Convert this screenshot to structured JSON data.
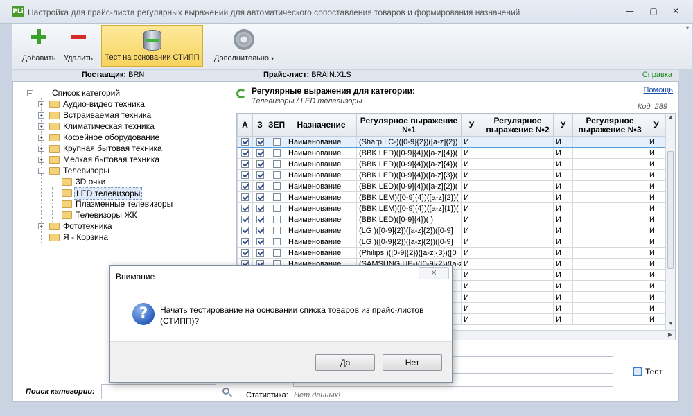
{
  "window": {
    "app_icon": "PLi",
    "title": "Настройка для прайс-листа регулярных выражений для автоматического сопоставления товаров и формирования назначений",
    "minimize": "—",
    "maximize": "▢",
    "close": "✕"
  },
  "ribbon": {
    "add_label": "Добавить",
    "delete_label": "Удалить",
    "test_label": "Тест на основании СТИПП",
    "more_label": "Дополнительно",
    "more_arrow": "▾"
  },
  "info": {
    "supplier_label": "Поставщик:",
    "supplier_value": "BRN",
    "pricelist_label": "Прайс-лист:",
    "pricelist_value": "BRAIN.XLS",
    "help": "Справка"
  },
  "tree": {
    "root": "Список категорий",
    "items": [
      "Аудио-видео техника",
      "Встраиваемая техника",
      "Климатическая техника",
      "Кофейное оборудование",
      "Крупная бытовая техника",
      "Мелкая бытовая техника",
      "Телевизоры"
    ],
    "tv_children": [
      "3D очки",
      "LED телевизоры",
      "Плазменные телевизоры",
      "Телевизоры ЖК"
    ],
    "after": [
      "Фототехника",
      "Я - Корзина"
    ]
  },
  "search": {
    "label": "Поиск категории:",
    "value": ""
  },
  "regex_panel": {
    "title": "Регулярные выражения для категории:",
    "path": "Телевизоры / LED телевизоры",
    "help": "Помощь",
    "code": "Код: 289",
    "columns": [
      "А",
      "З",
      "ЗЕП",
      "Назначение",
      "Регулярное выражение №1",
      "У",
      "Регулярное выражение №2",
      "У",
      "Регулярное выражение №3",
      "У"
    ],
    "rows": [
      {
        "a": true,
        "z": true,
        "zep": false,
        "purpose": "Наименование",
        "r1": "(Sharp LC-)([0-9]{2})([a-z]{2})",
        "u1": "И",
        "r2": "",
        "u2": "И",
        "r3": "",
        "u3": "И"
      },
      {
        "a": true,
        "z": true,
        "zep": false,
        "purpose": "Наименование",
        "r1": "(BBK LED)([0-9]{4})([a-z]{4})(",
        "u1": "И",
        "r2": "",
        "u2": "И",
        "r3": "",
        "u3": "И"
      },
      {
        "a": true,
        "z": true,
        "zep": false,
        "purpose": "Наименование",
        "r1": "(BBK LED)([0-9]{4})([a-z]{4})(",
        "u1": "И",
        "r2": "",
        "u2": "И",
        "r3": "",
        "u3": "И"
      },
      {
        "a": true,
        "z": true,
        "zep": false,
        "purpose": "Наименование",
        "r1": "(BBK LED)([0-9]{4})([a-z]{3})(",
        "u1": "И",
        "r2": "",
        "u2": "И",
        "r3": "",
        "u3": "И"
      },
      {
        "a": true,
        "z": true,
        "zep": false,
        "purpose": "Наименование",
        "r1": "(BBK LED)([0-9]{4})([a-z]{2})(",
        "u1": "И",
        "r2": "",
        "u2": "И",
        "r3": "",
        "u3": "И"
      },
      {
        "a": true,
        "z": true,
        "zep": false,
        "purpose": "Наименование",
        "r1": "(BBK LEM)([0-9]{4})([a-z]{2})(",
        "u1": "И",
        "r2": "",
        "u2": "И",
        "r3": "",
        "u3": "И"
      },
      {
        "a": true,
        "z": true,
        "zep": false,
        "purpose": "Наименование",
        "r1": "(BBK LEM)([0-9]{4})([a-z]{1})(",
        "u1": "И",
        "r2": "",
        "u2": "И",
        "r3": "",
        "u3": "И"
      },
      {
        "a": true,
        "z": true,
        "zep": false,
        "purpose": "Наименование",
        "r1": "(BBK LED)([0-9]{4})( )",
        "u1": "И",
        "r2": "",
        "u2": "И",
        "r3": "",
        "u3": "И"
      },
      {
        "a": true,
        "z": true,
        "zep": false,
        "purpose": "Наименование",
        "r1": "(LG )([0-9]{2})([a-z]{2})([0-9]",
        "u1": "И",
        "r2": "",
        "u2": "И",
        "r3": "",
        "u3": "И"
      },
      {
        "a": true,
        "z": true,
        "zep": false,
        "purpose": "Наименование",
        "r1": "(LG )([0-9]{2})([a-z]{2})([0-9]",
        "u1": "И",
        "r2": "",
        "u2": "И",
        "r3": "",
        "u3": "И"
      },
      {
        "a": true,
        "z": true,
        "zep": false,
        "purpose": "Наименование",
        "r1": "(Philips )([0-9]{2})([a-z]{3})([0",
        "u1": "И",
        "r2": "",
        "u2": "И",
        "r3": "",
        "u3": "И"
      },
      {
        "a": true,
        "z": true,
        "zep": false,
        "purpose": "Наименование",
        "r1": "(SAMSUNG UE-)([0-9]{2})([a-z",
        "u1": "И",
        "r2": "",
        "u2": "И",
        "r3": "",
        "u3": "И"
      },
      {
        "a": true,
        "z": true,
        "zep": false,
        "purpose": "",
        "r1": "",
        "u1": "И",
        "r2": "",
        "u2": "И",
        "r3": "",
        "u3": "И"
      },
      {
        "a": true,
        "z": true,
        "zep": false,
        "purpose": "",
        "r1": "",
        "u1": "И",
        "r2": "",
        "u2": "И",
        "r3": "",
        "u3": "И"
      },
      {
        "a": true,
        "z": true,
        "zep": false,
        "purpose": "",
        "r1": "",
        "u1": "И",
        "r2": "",
        "u2": "И",
        "r3": "",
        "u3": "И"
      },
      {
        "a": true,
        "z": true,
        "zep": false,
        "purpose": "",
        "r1": "",
        "u1": "И",
        "r2": "",
        "u2": "И",
        "r3": "",
        "u3": "И"
      },
      {
        "a": true,
        "z": true,
        "zep": false,
        "purpose": "",
        "r1": "",
        "u1": "И",
        "r2": "",
        "u2": "И",
        "r3": "",
        "u3": "И"
      }
    ]
  },
  "test": {
    "label": "Тест"
  },
  "stats": {
    "label": "Статистика:",
    "value": "Нет данных!"
  },
  "dialog": {
    "title": "Внимание",
    "close": "✕",
    "icon": "?",
    "message": "Начать тестирование на основании списка товаров из прайс-листов (СТИПП)?",
    "yes": "Да",
    "no": "Нет"
  }
}
